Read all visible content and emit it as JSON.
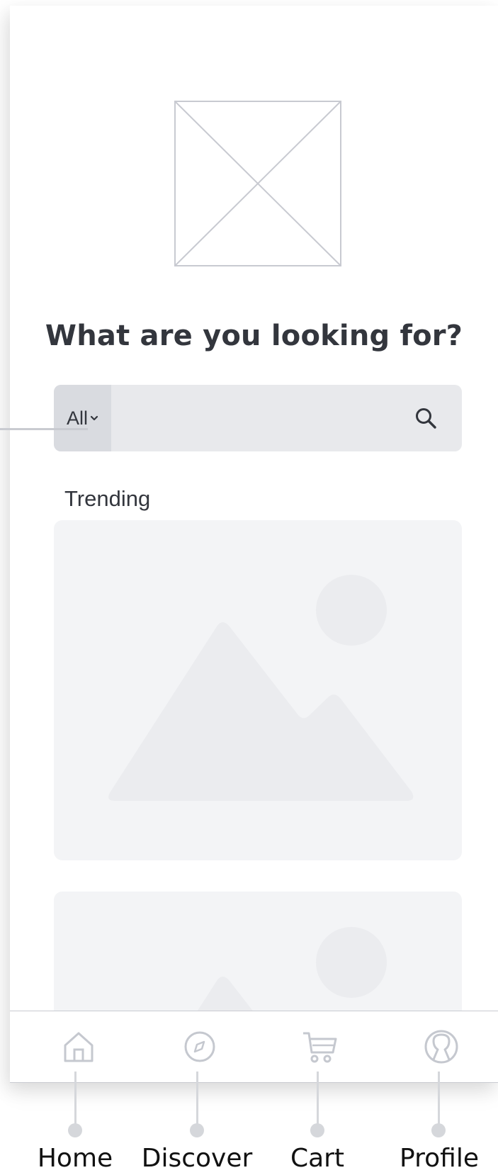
{
  "header": {
    "logo_icon": "image-placeholder-x-icon"
  },
  "hero": {
    "headline": "What are you looking for?"
  },
  "search": {
    "category_label": "All",
    "category_icon": "chevron-down-icon",
    "input_value": "",
    "input_placeholder": "",
    "icon": "search-icon"
  },
  "trending": {
    "title": "Trending",
    "cards": [
      {
        "icon": "image-placeholder-icon"
      },
      {
        "icon": "image-placeholder-icon"
      }
    ]
  },
  "bottom_nav": {
    "items": [
      {
        "icon": "home-icon"
      },
      {
        "icon": "compass-icon"
      },
      {
        "icon": "cart-icon"
      },
      {
        "icon": "profile-icon"
      }
    ]
  },
  "callouts": {
    "home": "Home",
    "discover": "Discover",
    "cart": "Cart",
    "profile": "Profile"
  },
  "colors": {
    "text_primary": "#33363d",
    "search_bg": "#e8e9ec",
    "category_bg": "#d9dbe0",
    "card_bg": "#f3f4f6",
    "placeholder_shape": "#ebecef",
    "icon_stroke": "#c5c8cf",
    "callout_line": "#d5d7db"
  }
}
